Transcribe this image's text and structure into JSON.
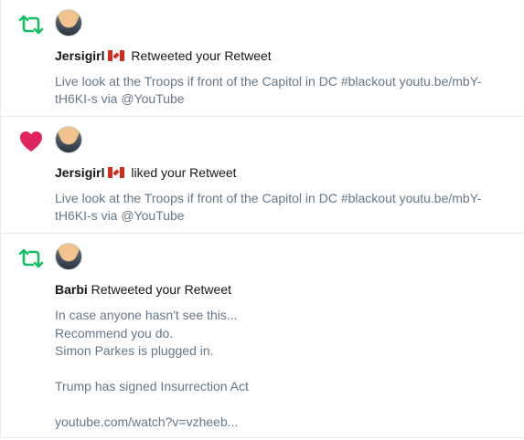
{
  "notifications": [
    {
      "type": "retweet",
      "icon": "retweet-icon",
      "icon_color": "#17bf63",
      "user": "Jersigirl",
      "flag": "canada-flag-icon",
      "action": " Retweeted your Retweet",
      "text": "Live look at the Troops if front of the Capitol in DC #blackout youtu.be/mbY-\ntH6KI-s via @YouTube"
    },
    {
      "type": "like",
      "icon": "heart-icon",
      "icon_color": "#e0245e",
      "user": "Jersigirl",
      "flag": "canada-flag-icon",
      "action": " liked your Retweet",
      "text": "Live look at the Troops if front of the Capitol in DC #blackout youtu.be/mbY-\ntH6KI-s via @YouTube"
    },
    {
      "type": "retweet",
      "icon": "retweet-icon",
      "icon_color": "#17bf63",
      "user": "Barbi",
      "action": " Retweeted your Retweet",
      "text": "In case anyone hasn't see this...\nRecommend you do.\nSimon Parkes is plugged in.\n\nTrump has signed Insurrection Act\n\nyoutube.com/watch?v=vzheeb..."
    }
  ]
}
